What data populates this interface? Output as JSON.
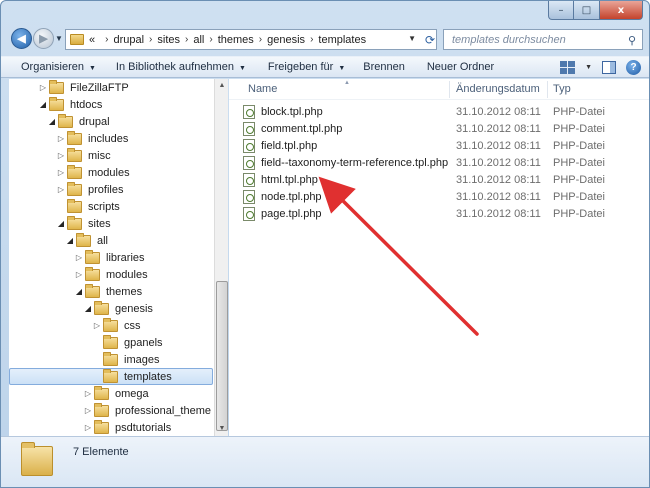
{
  "window": {
    "caption_min": "–",
    "caption_max": "□",
    "caption_close": "x"
  },
  "address": {
    "overflow": "«",
    "crumbs": [
      "drupal",
      "sites",
      "all",
      "themes",
      "genesis",
      "templates"
    ],
    "separator": "›"
  },
  "search": {
    "placeholder": "templates durchsuchen"
  },
  "toolbar": {
    "organize": "Organisieren",
    "library": "In Bibliothek aufnehmen",
    "share": "Freigeben für",
    "burn": "Brennen",
    "new_folder": "Neuer Ordner"
  },
  "tree": [
    {
      "label": "FileZillaFTP",
      "depth": 0,
      "expander": "closed"
    },
    {
      "label": "htdocs",
      "depth": 0,
      "expander": "open"
    },
    {
      "label": "drupal",
      "depth": 1,
      "expander": "open"
    },
    {
      "label": "includes",
      "depth": 2,
      "expander": "closed"
    },
    {
      "label": "misc",
      "depth": 2,
      "expander": "closed"
    },
    {
      "label": "modules",
      "depth": 2,
      "expander": "closed"
    },
    {
      "label": "profiles",
      "depth": 2,
      "expander": "closed"
    },
    {
      "label": "scripts",
      "depth": 2,
      "expander": "none"
    },
    {
      "label": "sites",
      "depth": 2,
      "expander": "open"
    },
    {
      "label": "all",
      "depth": 3,
      "expander": "open"
    },
    {
      "label": "libraries",
      "depth": 4,
      "expander": "closed"
    },
    {
      "label": "modules",
      "depth": 4,
      "expander": "closed"
    },
    {
      "label": "themes",
      "depth": 4,
      "expander": "open"
    },
    {
      "label": "genesis",
      "depth": 5,
      "expander": "open"
    },
    {
      "label": "css",
      "depth": 6,
      "expander": "closed"
    },
    {
      "label": "gpanels",
      "depth": 6,
      "expander": "none"
    },
    {
      "label": "images",
      "depth": 6,
      "expander": "none"
    },
    {
      "label": "templates",
      "depth": 6,
      "expander": "none",
      "selected": true
    },
    {
      "label": "omega",
      "depth": 5,
      "expander": "closed"
    },
    {
      "label": "professional_theme",
      "depth": 5,
      "expander": "closed"
    },
    {
      "label": "psdtutorials",
      "depth": 5,
      "expander": "closed"
    }
  ],
  "columns": {
    "name": "Name",
    "date": "Änderungsdatum",
    "type": "Typ"
  },
  "files": [
    {
      "name": "block.tpl.php",
      "date": "31.10.2012 08:11",
      "type": "PHP-Datei"
    },
    {
      "name": "comment.tpl.php",
      "date": "31.10.2012 08:11",
      "type": "PHP-Datei"
    },
    {
      "name": "field.tpl.php",
      "date": "31.10.2012 08:11",
      "type": "PHP-Datei"
    },
    {
      "name": "field--taxonomy-term-reference.tpl.php",
      "date": "31.10.2012 08:11",
      "type": "PHP-Datei"
    },
    {
      "name": "html.tpl.php",
      "date": "31.10.2012 08:11",
      "type": "PHP-Datei"
    },
    {
      "name": "node.tpl.php",
      "date": "31.10.2012 08:11",
      "type": "PHP-Datei"
    },
    {
      "name": "page.tpl.php",
      "date": "31.10.2012 08:11",
      "type": "PHP-Datei"
    }
  ],
  "details": {
    "count_text": "7 Elemente"
  },
  "colors": {
    "annotation_arrow": "#e03030",
    "selection": "#cce1f6"
  }
}
